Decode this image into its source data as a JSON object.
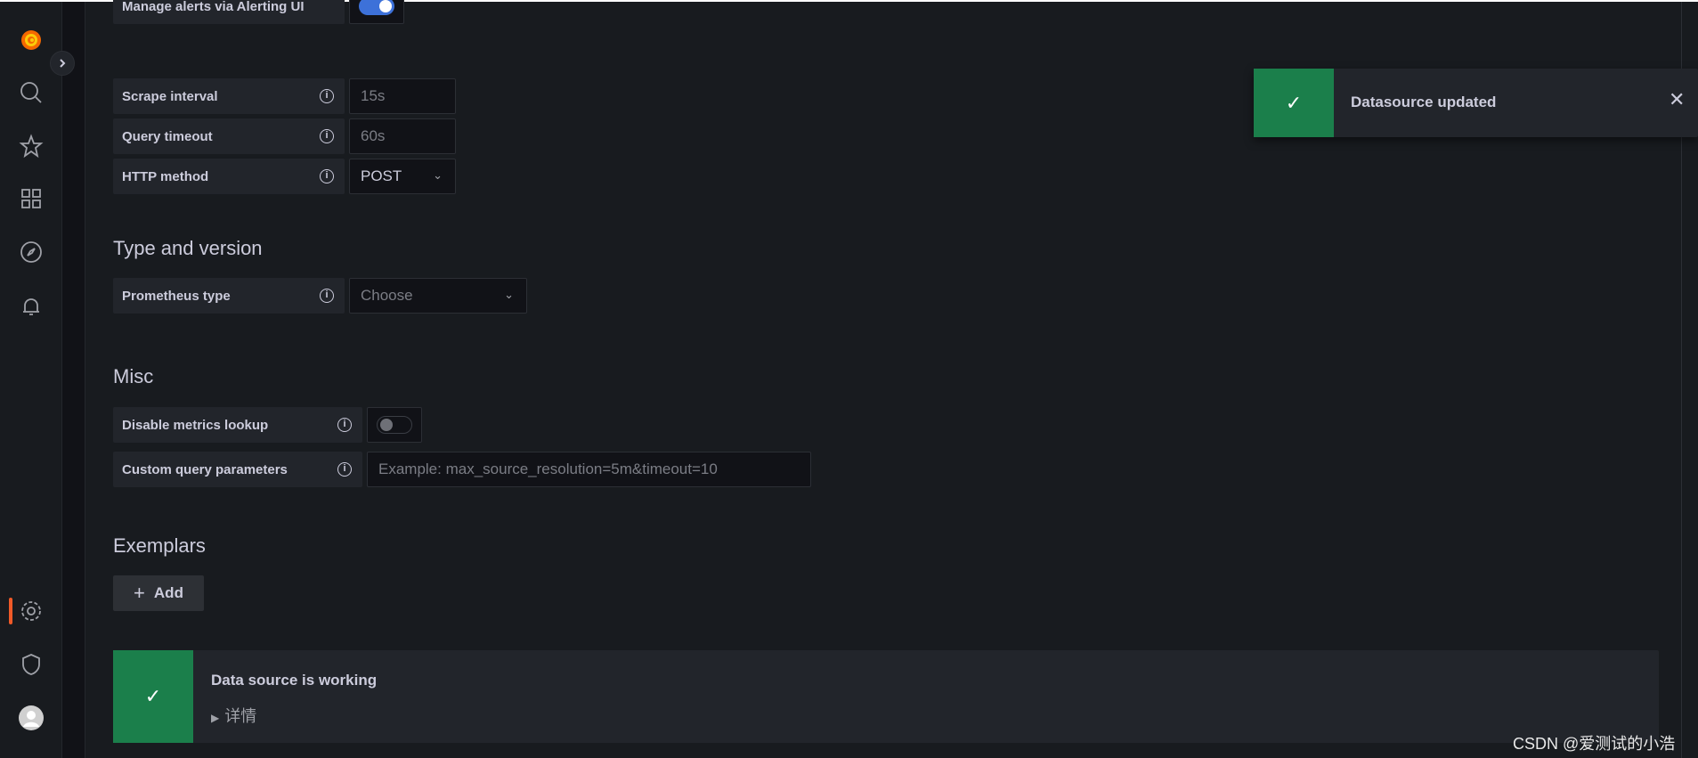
{
  "form": {
    "manage_alerts": {
      "label": "Manage alerts via Alerting UI",
      "enabled": true
    },
    "scrape_interval": {
      "label": "Scrape interval",
      "placeholder": "15s"
    },
    "query_timeout": {
      "label": "Query timeout",
      "placeholder": "60s"
    },
    "http_method": {
      "label": "HTTP method",
      "value": "POST"
    },
    "type_section": "Type and version",
    "prometheus_type": {
      "label": "Prometheus type",
      "placeholder": "Choose"
    },
    "misc_section": "Misc",
    "disable_metrics_lookup": {
      "label": "Disable metrics lookup",
      "enabled": false
    },
    "custom_query": {
      "label": "Custom query parameters",
      "placeholder": "Example: max_source_resolution=5m&timeout=10"
    },
    "exemplars_section": "Exemplars",
    "add_label": "Add"
  },
  "status": {
    "title": "Data source is working",
    "details": "详情"
  },
  "toast": {
    "message": "Datasource updated"
  },
  "watermark": "CSDN @爱测试的小浩",
  "colors": {
    "success": "#1b7f4b",
    "accent": "#f05a28",
    "toggle_on": "#3d71d9"
  }
}
